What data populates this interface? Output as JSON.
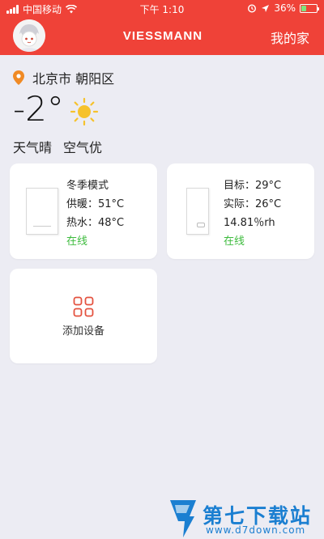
{
  "status_bar": {
    "carrier": "中国移动",
    "time": "下午 1:10",
    "battery": "36%",
    "battery_level": 0.36
  },
  "header": {
    "brand": "VIESSMANN",
    "my_home": "我的家",
    "bg_color": "#ef4238"
  },
  "location": {
    "city": "北京市 朝阳区"
  },
  "weather": {
    "temperature": "-2°",
    "condition": "天气晴",
    "air_quality": "空气优",
    "icon": "sun-icon"
  },
  "devices": [
    {
      "mode": "冬季模式",
      "heating": "供暖：51°C",
      "hot_water": "热水：48°C",
      "status": "在线"
    },
    {
      "target": "目标：29°C",
      "actual": "实际：26°C",
      "humidity": "14.81％rh",
      "status": "在线"
    }
  ],
  "add_device": {
    "label": "添加设备",
    "icon": "grid-add-icon"
  },
  "watermark": {
    "text": "第七下载站",
    "url": "www.d7down.com"
  },
  "colors": {
    "accent": "#ef4238",
    "online": "#3dbb3d",
    "background": "#ececf3"
  }
}
